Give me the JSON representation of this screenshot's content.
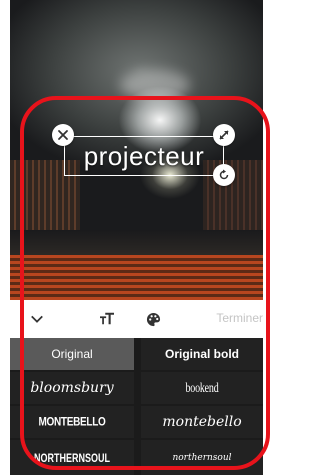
{
  "overlay": {
    "text": "projecteur",
    "delete_icon": "close-icon",
    "resize_icon": "resize-diagonal-icon",
    "rotate_icon": "rotate-icon"
  },
  "toolbar": {
    "collapse_icon": "chevron-down-icon",
    "text_size_icon": "text-size-icon",
    "color_icon": "palette-icon",
    "done_label": "Terminer"
  },
  "fonts": [
    {
      "label": "Original",
      "selected": true
    },
    {
      "label": "Original bold",
      "selected": false
    },
    {
      "label": "bloomsbury",
      "selected": false
    },
    {
      "label": "bookend",
      "selected": false
    },
    {
      "label": "MONTEBELLO",
      "selected": false
    },
    {
      "label": "montebello",
      "selected": false
    },
    {
      "label": "NORTHERNSOUL",
      "selected": false
    },
    {
      "label": "northernsoul",
      "selected": false
    }
  ],
  "colors": {
    "highlight_frame": "#e8131b",
    "grid_background": "#1b1b1b",
    "selected_cell": "#5a5a5a"
  }
}
